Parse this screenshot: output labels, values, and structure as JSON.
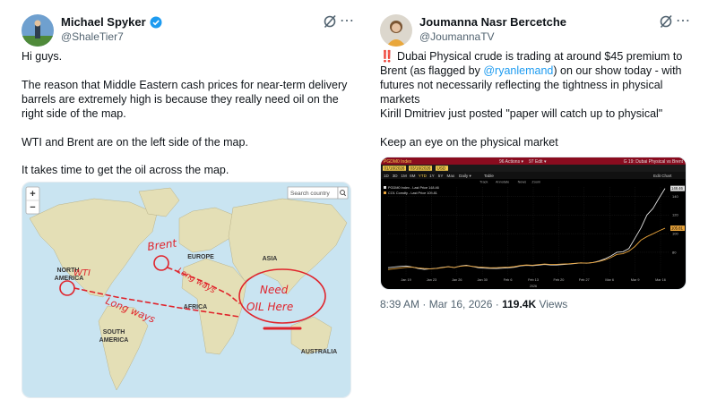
{
  "tweet1": {
    "author_name": "Michael Spyker",
    "handle": "@ShaleTier7",
    "paragraphs": [
      "Hi guys.",
      "The reason that Middle Eastern cash prices for near-term delivery barrels are extremely high is because they really need oil on the right side of the map.",
      "WTI and Brent are on the left side of the map.",
      "It takes time to get the oil across the map."
    ],
    "map": {
      "zoom_in": "+",
      "zoom_out": "−",
      "search_placeholder": "Search country",
      "continents": {
        "europe": "EUROPE",
        "asia": "ASIA",
        "north_america_a": "NORTH",
        "north_america_b": "AMERICA",
        "africa": "AFRICA",
        "south_america_a": "SOUTH",
        "south_america_b": "AMERICA",
        "australia": "AUSTRALIA"
      },
      "annotations": {
        "brent": "Brent",
        "wti": "WTI",
        "long_ways_1": "Long ways",
        "long_ways_2": "Long ways",
        "need": "Need",
        "oil_here": "OIL Here"
      }
    }
  },
  "tweet2": {
    "author_name": "Joumanna Nasr Bercetche",
    "handle": "@JoumannaTV",
    "alert_icon": "‼️",
    "line1_pre": " Dubai Physical crude is trading at around $45 premium to Brent (as flagged by ",
    "mention": "@ryanlemand",
    "line1_post": ") on our show today - with futures not necessarily reflecting the tightness in physical markets",
    "para2": "Kirill Dmitriev just posted \"paper will catch up to physical\"",
    "para3": "Keep an eye on the physical market",
    "timestamp": "8:39 AM · Mar 16, 2026 · ",
    "views_count": "119.4K",
    "views_label": " Views",
    "terminal": {
      "ticker": "PGDM0 Index",
      "actions": "96 Actions ▾",
      "edit": "97 Edit ▾",
      "title": "G 19: Dubai Physical vs Brent",
      "date_from": "01/16/2026",
      "date_to": "03/16/2026",
      "currency": "USD",
      "periods": [
        "1D",
        "3D",
        "1M",
        "6M",
        "YTD",
        "1Y",
        "5Y",
        "Max"
      ],
      "freq": "Daily ▾",
      "table_label": "Table",
      "tools": [
        "Track",
        "Annotate",
        "News",
        "Zoom"
      ],
      "edit_chart": "Edit Chart",
      "legend": [
        "PGDM0 Index - Last Price 148.46",
        "CO1 Comdty - Last Price 105.81"
      ],
      "year_label": "2026"
    }
  },
  "chart_data": {
    "type": "line",
    "title": "Dubai Physical vs Brent",
    "x_tick_labels": [
      "Jan 19",
      "Jan 23",
      "Jan 26",
      "Jan 30",
      "Feb 6",
      "Feb 13",
      "Feb 20",
      "Feb 27",
      "Mar 6",
      "Mar 9",
      "Mar 16"
    ],
    "y_tick_labels": [
      140,
      120,
      100,
      80
    ],
    "ylim": [
      55,
      150
    ],
    "series": [
      {
        "name": "PGDM0 Index",
        "color": "#e0e0e0",
        "values": [
          63.5,
          64.2,
          64.9,
          65.3,
          64.2,
          62.6,
          61.7,
          62.3,
          62.7,
          63.8,
          64.5,
          63.6,
          65.2,
          66.1,
          64.8,
          63.5,
          63,
          62.8,
          62.6,
          63,
          63.4,
          64,
          65.4,
          66,
          65.6,
          66.2,
          66.9,
          66.3,
          66.4,
          66.8,
          67.3,
          67.9,
          68.6,
          68.3,
          69,
          70.5,
          72.9,
          76,
          80,
          80.5,
          84,
          95,
          106,
          120,
          127,
          138,
          148.46
        ]
      },
      {
        "name": "CO1 Comdty",
        "color": "#e8a33b",
        "values": [
          61.5,
          62.3,
          63.1,
          63.8,
          64.1,
          63.2,
          62.6,
          62.3,
          62.6,
          63.5,
          64.5,
          63.7,
          65,
          65.6,
          64.9,
          64.2,
          63.8,
          63.3,
          63.5,
          63.8,
          64,
          64.6,
          65.9,
          66.4,
          66.1,
          66.8,
          67.4,
          66.9,
          67.1,
          67.4,
          67.6,
          68.1,
          68.6,
          68.4,
          68.9,
          70.1,
          71.8,
          74.3,
          77.7,
          78.5,
          81.2,
          86.2,
          93,
          96.8,
          99.8,
          103,
          105.81
        ]
      }
    ]
  }
}
